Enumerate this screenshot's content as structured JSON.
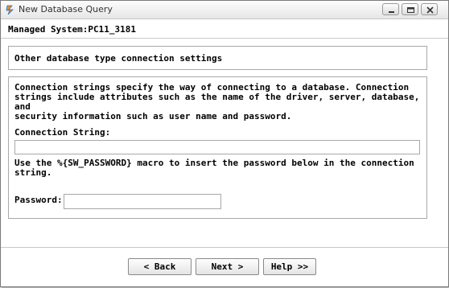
{
  "window": {
    "title": "New Database Query",
    "icon": "app-logo-icon",
    "controls": [
      "minimize-icon",
      "maximize-icon",
      "close-icon"
    ]
  },
  "header": {
    "managed_system": "Managed System:PC11_3181"
  },
  "section": {
    "title": "Other database type connection settings",
    "description": "Connection strings specify the way of connecting to a database. Connection\nstrings include attributes such as the name of the driver, server, database, and\nsecurity information such as user name and password.",
    "connection_string_label": "Connection String:",
    "connection_string_value": "",
    "hint": "Use the %{SW_PASSWORD} macro to insert the password below in the connection\nstring.",
    "password_label": "Password:",
    "password_value": ""
  },
  "buttons": {
    "back": "< Back",
    "next": "Next >",
    "help": "Help >>"
  },
  "colors": {
    "border": "#a8a8a8",
    "titlebar_top": "#fdfdfd",
    "titlebar_bottom": "#e6e6e6",
    "icon_blue": "#2f6fc0",
    "icon_orange": "#e8901c"
  }
}
